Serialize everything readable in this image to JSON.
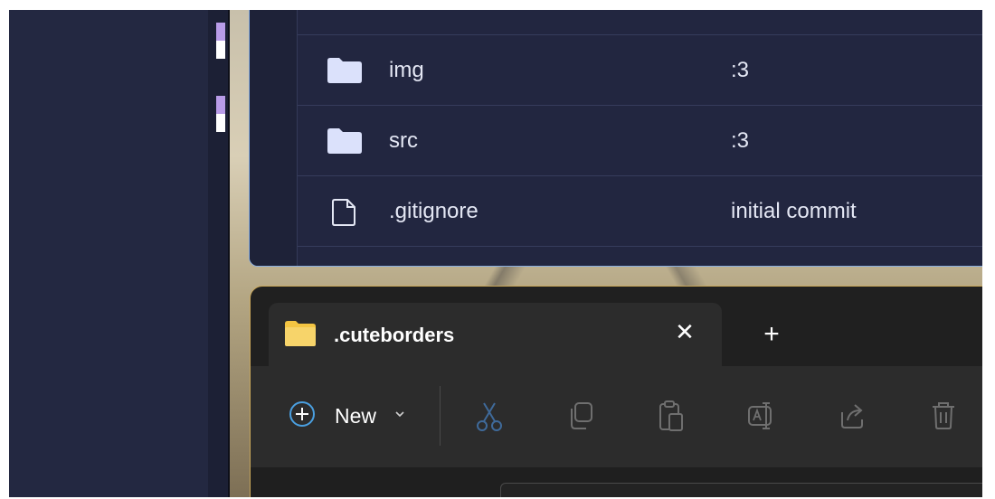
{
  "git_files": {
    "rows": [
      {
        "name": "",
        "message": "",
        "icon": "folder-icon"
      },
      {
        "name": "img",
        "message": ":3",
        "icon": "folder-icon"
      },
      {
        "name": "src",
        "message": ":3",
        "icon": "folder-icon"
      },
      {
        "name": ".gitignore",
        "message": "initial commit",
        "icon": "file-icon"
      }
    ]
  },
  "explorer": {
    "tab": {
      "title": ".cuteborders",
      "close": "✕",
      "icon": "folder-icon"
    },
    "new_tab": "+",
    "toolbar": {
      "new_label": "New",
      "buttons": [
        "cut-icon",
        "copy-icon",
        "paste-icon",
        "rename-icon",
        "share-icon",
        "delete-icon"
      ]
    }
  },
  "colors": {
    "desktop_bg": "#232841",
    "git_bg": "#222640",
    "git_border": "#8aaee0",
    "folder_fill": "#dbe1fb",
    "explorer_bg": "#202020",
    "explorer_border": "#c9a75a",
    "yellow_folder": "#f4c542",
    "accent_blue": "#4a9fe0",
    "marker_purple": "#b99ce8"
  }
}
